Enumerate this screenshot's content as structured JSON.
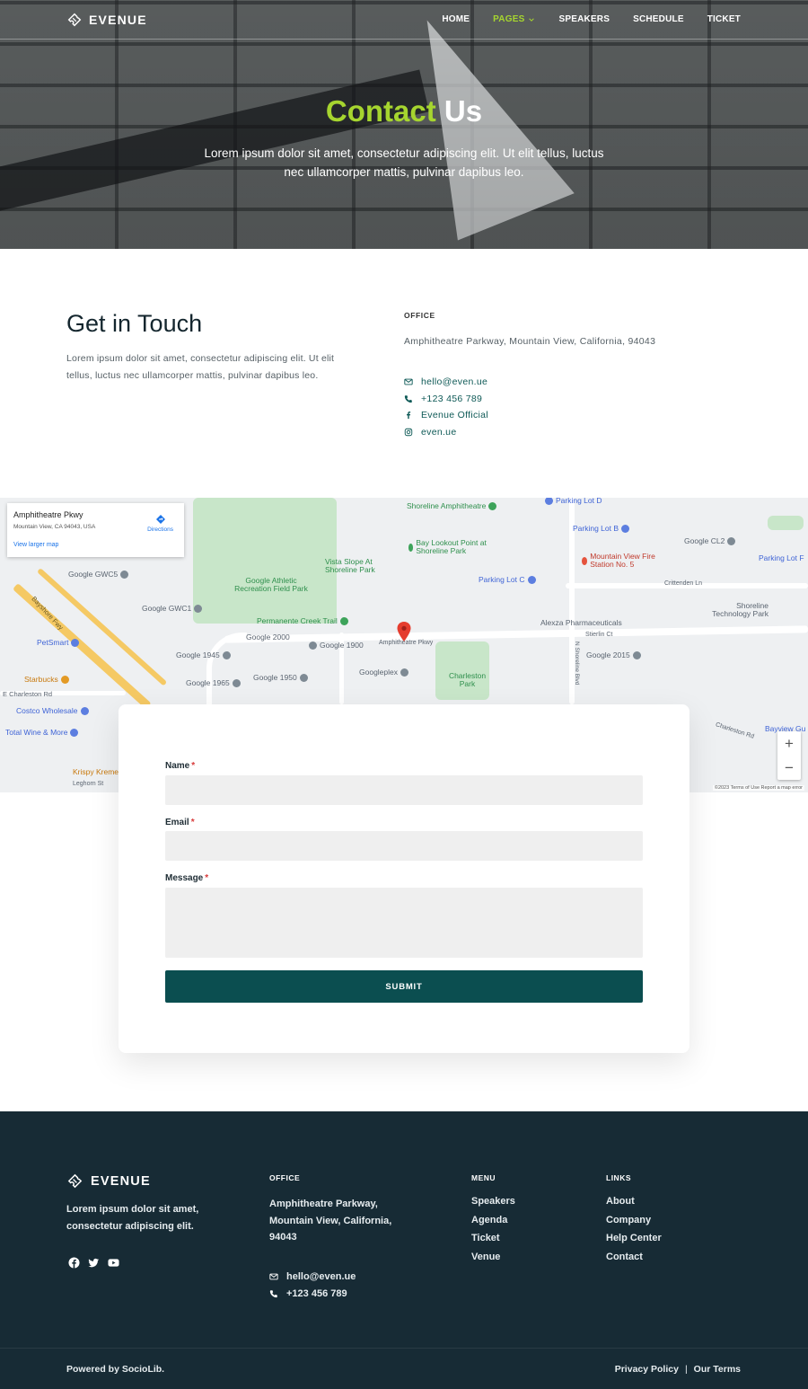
{
  "brand": {
    "name": "EVENUE"
  },
  "nav": {
    "items": [
      {
        "label": "HOME"
      },
      {
        "label": "PAGES"
      },
      {
        "label": "SPEAKERS"
      },
      {
        "label": "SCHEDULE"
      },
      {
        "label": "TICKET"
      }
    ],
    "active": "PAGES",
    "accent_color": "#a6d52f"
  },
  "hero": {
    "title_highlight": "Contact",
    "title_rest": " Us",
    "subtitle": "Lorem ipsum dolor sit amet, consectetur adipiscing elit. Ut elit tellus, luctus nec ullamcorper mattis, pulvinar dapibus leo."
  },
  "contact": {
    "heading": "Get in Touch",
    "description": "Lorem ipsum dolor sit amet, consectetur adipiscing elit. Ut elit tellus, luctus nec ullamcorper mattis, pulvinar dapibus leo.",
    "office_label": "OFFICE",
    "office_address": "Amphitheatre Parkway, Mountain View, California, 94043",
    "items": [
      {
        "icon": "envelope-icon",
        "text": "hello@even.ue"
      },
      {
        "icon": "phone-icon",
        "text": "+123 456 789"
      },
      {
        "icon": "facebook-icon",
        "text": "Evenue Official"
      },
      {
        "icon": "instagram-icon",
        "text": "even.ue"
      }
    ]
  },
  "map": {
    "card_title": "Amphitheatre Pkwy",
    "card_address": "Mountain View, CA 94043, USA",
    "card_link": "View larger map",
    "directions": "Directions",
    "zoom_in": "+",
    "zoom_out": "−",
    "attribution": "©2023  Terms of Use   Report a map error",
    "labels": {
      "shoreline_amph": "Shoreline Amphitheatre",
      "parking_d": "Parking Lot D",
      "parking_b": "Parking Lot B",
      "google_cl2": "Google CL2",
      "parking_f": "Parking Lot F",
      "bay_lookout": "Bay Lookout Point at Shoreline Park",
      "mv_fire": "Mountain View Fire Station No. 5",
      "vista_slope": "Vista Slope At Shoreline Park",
      "google_gwc5": "Google GWC5",
      "google_athletic": "Google Athletic Recreation Field Park",
      "parking_c": "Parking Lot C",
      "crittenden": "Crittenden Ln",
      "shoreline_tech": "Shoreline Technology Park",
      "google_gwc1": "Google GWC1",
      "permanente": "Permanente Creek Trail",
      "alexza": "Alexza Pharmaceuticals",
      "google_2000": "Google 2000",
      "google_1900": "Google 1900",
      "amph_pkwy": "Amphitheatre Pkwy",
      "stierlin": "Stierlin Ct",
      "google_2015": "Google 2015",
      "petsmart": "PetSmart",
      "google_1945": "Google 1945",
      "googleplex": "Googleplex",
      "charleston_park": "Charleston Park",
      "google_1965": "Google 1965",
      "google_1950": "Google 1950",
      "starbucks": "Starbucks",
      "e_charleston": "E Charleston Rd",
      "costco": "Costco Wholesale",
      "total_wine": "Total Wine & More",
      "charleston_rd": "Charleston Rd",
      "bayview": "Bayview Gu",
      "krispy": "Krispy Kreme",
      "leghorn": "Leghorn St",
      "bayshore": "Bayshore Fwy",
      "shoreline_blvd": "N Shoreline Blvd"
    }
  },
  "form": {
    "name_label": "Name",
    "email_label": "Email",
    "message_label": "Message",
    "required_mark": "*",
    "submit_label": "SUBMIT",
    "button_color": "#0b4e50"
  },
  "footer": {
    "brand": "EVENUE",
    "description": "Lorem ipsum dolor sit amet, consectetur adipiscing elit.",
    "social": [
      "facebook-icon",
      "twitter-icon",
      "youtube-icon"
    ],
    "office_heading": "OFFICE",
    "office_address": "Amphitheatre Parkway, Mountain View, California, 94043",
    "email": "hello@even.ue",
    "phone": "+123 456 789",
    "menu_heading": "MENU",
    "menu": [
      {
        "label": "Speakers"
      },
      {
        "label": "Agenda"
      },
      {
        "label": "Ticket"
      },
      {
        "label": "Venue"
      }
    ],
    "links_heading": "LINKS",
    "links": [
      {
        "label": "About"
      },
      {
        "label": "Company"
      },
      {
        "label": "Help Center"
      },
      {
        "label": "Contact"
      }
    ],
    "powered": "Powered by SocioLib.",
    "privacy": "Privacy Policy",
    "separator": "|",
    "terms": "Our Terms",
    "background": "#172b35"
  }
}
